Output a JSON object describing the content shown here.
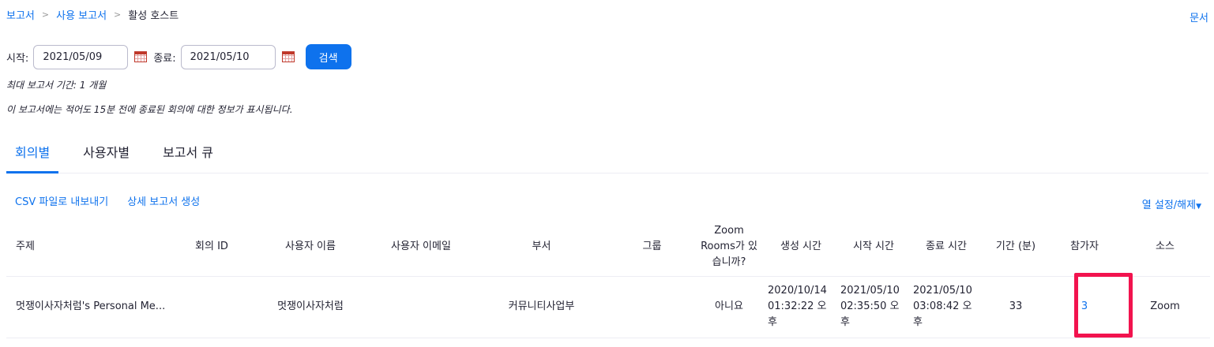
{
  "breadcrumb": {
    "items": [
      "보고서",
      "사용 보고서"
    ],
    "current": "활성 호스트",
    "separator": ">"
  },
  "doc_link": "문서",
  "filters": {
    "start_label": "시작:",
    "start_value": "2021/05/09",
    "end_label": "종료:",
    "end_value": "2021/05/10",
    "search_label": "검색"
  },
  "notes": {
    "max_period": "최대 보고서 기간: 1 개월",
    "info": "이 보고서에는 적어도 15분 전에 종료된 회의에 대한 정보가 표시됩니다."
  },
  "tabs": [
    {
      "label": "회의별",
      "active": true
    },
    {
      "label": "사용자별",
      "active": false
    },
    {
      "label": "보고서 큐",
      "active": false
    }
  ],
  "actions": {
    "export_csv": "CSV 파일로 내보내기",
    "generate_detail": "상세 보고서 생성",
    "column_toggle": "열 설정/해제"
  },
  "table": {
    "headers": {
      "topic": "주제",
      "meeting_id": "회의 ID",
      "user_name": "사용자 이름",
      "user_email": "사용자 이메일",
      "department": "부서",
      "group": "그룹",
      "zoom_rooms": "Zoom Rooms가 있습니까?",
      "created": "생성 시간",
      "start": "시작 시간",
      "end": "종료 시간",
      "duration": "기간 (분)",
      "participants": "참가자",
      "source": "소스"
    },
    "rows": [
      {
        "topic": "멋쟁이사자처럼's Personal Me...",
        "meeting_id": "",
        "user_name": "멋쟁이사자처럼",
        "user_email": "",
        "department": "커뮤니티사업부",
        "group": "",
        "zoom_rooms": "아니요",
        "created": "2020/10/14 01:32:22 오후",
        "start": "2021/05/10 02:35:50 오후",
        "end": "2021/05/10 03:08:42 오후",
        "duration": "33",
        "participants": "3",
        "source": "Zoom"
      }
    ]
  },
  "colors": {
    "accent": "#0e72ed",
    "highlight": "#f2134e"
  }
}
